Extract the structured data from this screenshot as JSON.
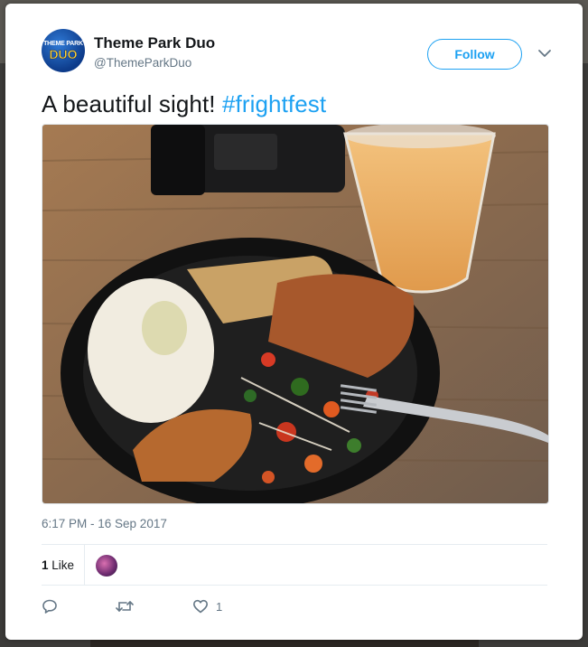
{
  "tweet": {
    "author": {
      "name": "Theme Park Duo",
      "handle": "@ThemeParkDuo",
      "avatar_text_top": "THEME PARK",
      "avatar_text_bottom": "DUO"
    },
    "follow_label": "Follow",
    "text": "A beautiful sight!",
    "hashtag": "#frightfest",
    "timestamp": "6:17 PM - 16 Sep 2017",
    "likes": {
      "count": "1",
      "label": "Like"
    },
    "actions": {
      "reply_icon": "reply-icon",
      "retweet_icon": "retweet-icon",
      "like_icon": "heart-icon",
      "like_count": "1"
    }
  },
  "colors": {
    "accent": "#1da1f2",
    "secondary_text": "#657786",
    "primary_text": "#14171a",
    "divider": "#e6ecf0"
  }
}
